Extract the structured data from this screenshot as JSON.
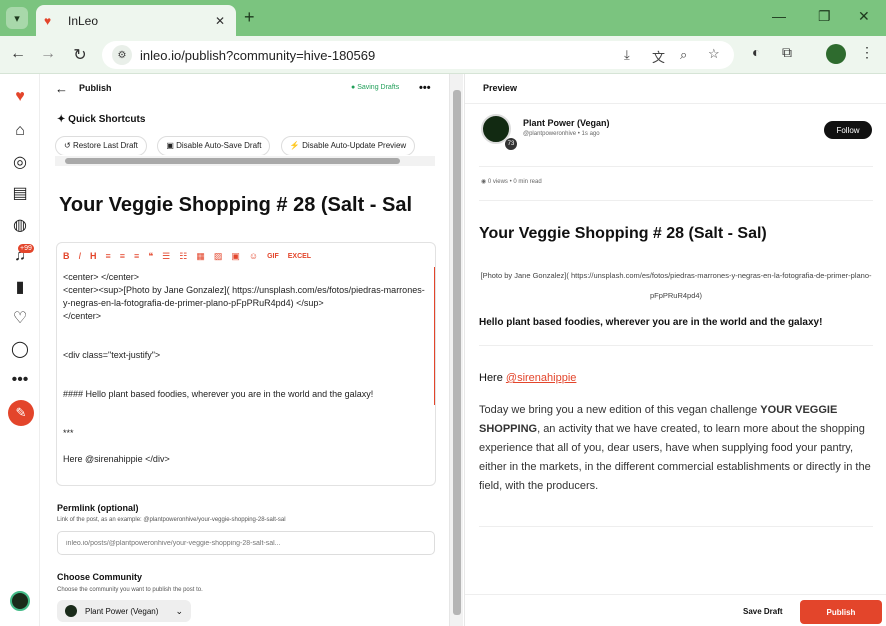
{
  "browser": {
    "tab_title": "InLeo",
    "url": "inleo.io/publish?community=hive-180569"
  },
  "editor": {
    "header_title": "Publish",
    "saving_status": "Saving Drafts",
    "quick_shortcuts_title": "Quick Shortcuts",
    "shortcuts": [
      "Restore Last Draft",
      "Disable Auto-Save Draft",
      "Disable Auto-Update Preview"
    ],
    "post_title": "Your Veggie Shopping # 28 (Salt - Sal",
    "markdown_lines": [
      "<center> </center>",
      "<center><sup>[Photo by Jane Gonzalez]( https://unsplash.com/es/fotos/piedras-marrones-y-negras-en-la-fotografia-de-primer-plano-pFpPRuR4pd4) </sup>",
      "</center>",
      "",
      "",
      "<div class=\"text-justify\">",
      "",
      "",
      "#### Hello plant based foodies, wherever you are in the world and the galaxy!",
      "",
      "",
      "***",
      "",
      "Here @sirenahippie </div>"
    ],
    "permlink_label": "Permlink (optional)",
    "permlink_hint": "Link of the post, as an example: @plantpoweronhive/your-veggie-shopping-28-salt-sal",
    "permlink_placeholder": "inleo.io/posts/@plantpoweronhive/your-veggie-shopping-28-salt-sal...",
    "community_label": "Choose Community",
    "community_hint": "Choose the community you want to publish the post to.",
    "community_selected": "Plant Power (Vegan)"
  },
  "rail": {
    "notification_count": "+99"
  },
  "preview": {
    "header_title": "Preview",
    "author_name": "Plant Power (Vegan)",
    "author_handle": "@plantpoweronhive • 1s ago",
    "author_level": "73",
    "follow_label": "Follow",
    "meta": "0 views • 0 min read",
    "post_title": "Your Veggie Shopping # 28 (Salt - Sal)",
    "photo_credit": "[Photo by Jane Gonzalez]( https://unsplash.com/es/fotos/piedras-marrones-y-negras-en-la-fotografia-de-primer-plano-pFpPRuR4pd4)",
    "hello_heading": "Hello plant based foodies, wherever you are in the world and the galaxy!",
    "here_text": "Here ",
    "mention": "@sirenahippie",
    "body_intro": "Today we bring you a new edition of this vegan challenge ",
    "body_bold": "YOUR VEGGIE SHOPPING",
    "body_rest": ", an activity that we have created, to learn more about the shopping experience that all of you, dear users, have when supplying food your pantry, either in the markets, in the different commercial establishments or directly in the field, with the producers.",
    "save_draft_label": "Save Draft",
    "publish_label": "Publish"
  },
  "colors": {
    "accent": "#e3452b",
    "chrome": "#7bc47f",
    "saving": "#22a05a"
  }
}
